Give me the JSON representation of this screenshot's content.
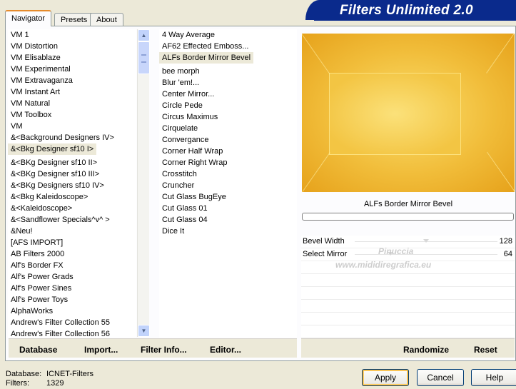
{
  "tabs": [
    {
      "label": "Navigator",
      "active": true
    },
    {
      "label": "Presets",
      "active": false
    },
    {
      "label": "About",
      "active": false
    }
  ],
  "brand": "Filters Unlimited 2.0",
  "categories": [
    "VM 1",
    "VM Distortion",
    "VM Elisablaze",
    "VM Experimental",
    "VM Extravaganza",
    "VM Instant Art",
    "VM Natural",
    "VM Toolbox",
    "VM",
    "&<Background Designers IV>",
    "&<Bkg Designer sf10 I>",
    "&<BKg Designer sf10 II>",
    "&<BKg Designer sf10 III>",
    "&<BKg Designers sf10 IV>",
    "&<Bkg Kaleidoscope>",
    "&<Kaleidoscope>",
    "&<Sandflower Specials^v^ >",
    "&Neu!",
    "[AFS IMPORT]",
    "AB Filters 2000",
    "Alf's Border FX",
    "Alf's Power Grads",
    "Alf's Power Sines",
    "Alf's Power Toys",
    "AlphaWorks",
    "Andrew's Filter Collection 55",
    "Andrew's Filter Collection 56"
  ],
  "selected_category_index": 10,
  "filters": [
    "4 Way Average",
    "AF62 Effected Emboss...",
    "ALFs Border Mirror Bevel",
    "bee morph",
    "Blur 'em!...",
    "Center Mirror...",
    "Circle Pede",
    "Circus Maximus",
    "Cirquelate",
    "Convergance",
    "Corner Half Wrap",
    "Corner Right Wrap",
    "Crosstitch",
    "Cruncher",
    "Cut Glass  BugEye",
    "Cut Glass 01",
    "Cut Glass 04",
    "Dice It"
  ],
  "selected_filter_index": 2,
  "filter_title": "ALFs Border Mirror Bevel",
  "params": [
    {
      "label": "Bevel Width",
      "value": "128",
      "level": 0.5
    },
    {
      "label": "Select Mirror",
      "value": "64",
      "level": 0.25
    }
  ],
  "watermark": {
    "line1": "Pinuccia",
    "line2": "www.mididiregrafica.eu"
  },
  "left_buttons": {
    "database": "Database",
    "import": "Import...",
    "filter_info": "Filter Info...",
    "editor": "Editor..."
  },
  "right_buttons": {
    "randomize": "Randomize",
    "reset": "Reset"
  },
  "footer": {
    "database_label": "Database:",
    "database_value": "ICNET-Filters",
    "filters_label": "Filters:",
    "filters_value": "1329"
  },
  "dialog_buttons": {
    "apply": "Apply",
    "cancel": "Cancel",
    "help": "Help"
  },
  "colors": {
    "brand_bg": "#0a2a8c",
    "tab_accent": "#e68b2c",
    "preview_gold": "#f1bd3a"
  }
}
